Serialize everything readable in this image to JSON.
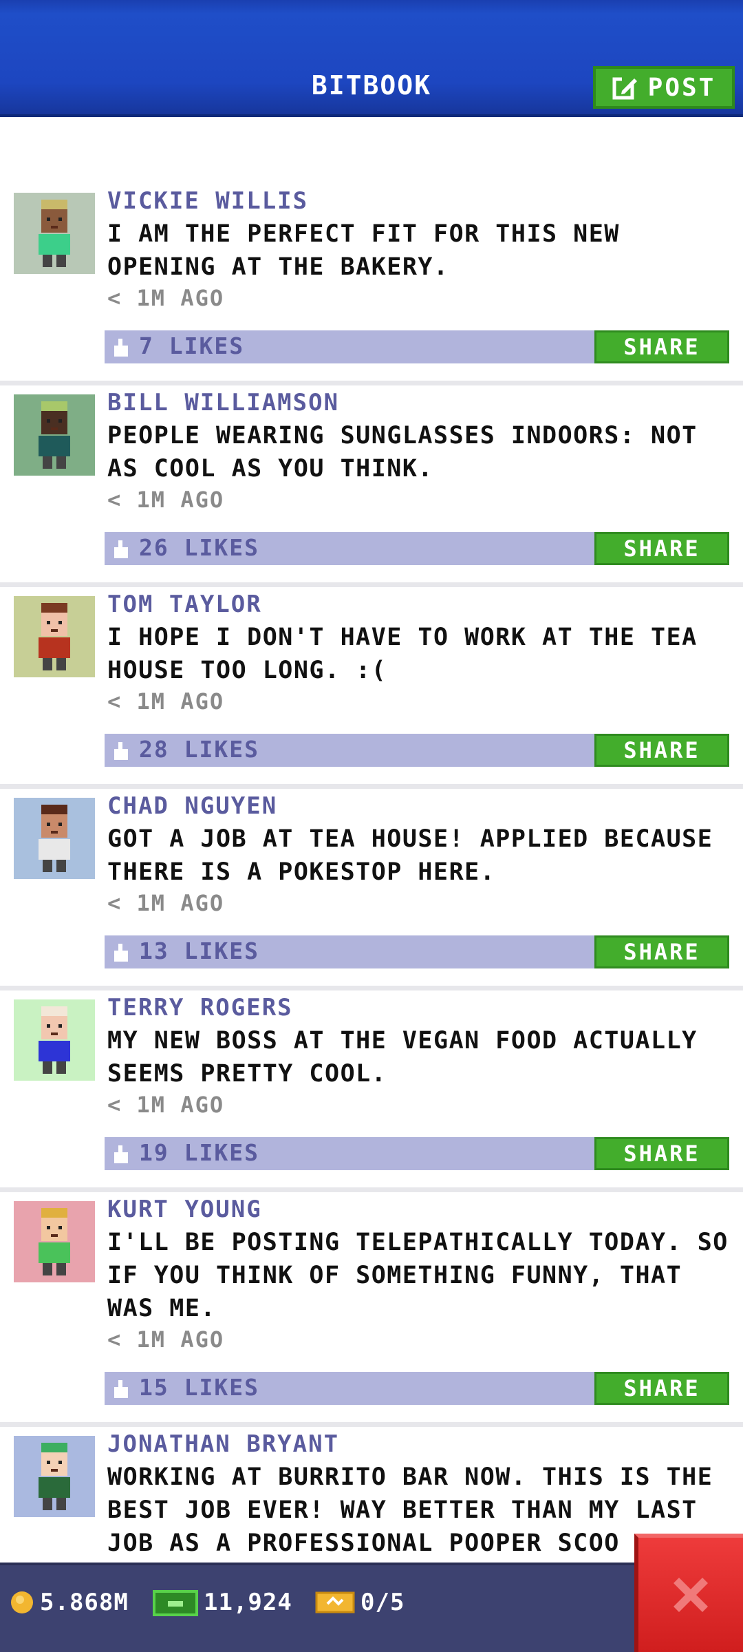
{
  "header": {
    "title": "BITBOOK",
    "post_label": "POST"
  },
  "posts": [
    {
      "name": "VICKIE WILLIS",
      "text": "I AM THE PERFECT FIT FOR THIS NEW OPENING AT THE BAKERY.",
      "time": "< 1M AGO",
      "likes": "7 LIKES",
      "share": "SHARE",
      "avatar_bg": "#b8c8b6",
      "skin": "#8a5a3c",
      "hair": "#c9b96a",
      "shirt": "#3ccf8a"
    },
    {
      "name": "BILL WILLIAMSON",
      "text": "PEOPLE WEARING SUNGLASSES INDOORS: NOT AS COOL AS YOU THINK.",
      "time": "< 1M AGO",
      "likes": "26 LIKES",
      "share": "SHARE",
      "avatar_bg": "#7fae86",
      "skin": "#4a2f22",
      "hair": "#a8c86a",
      "shirt": "#1f5a5a"
    },
    {
      "name": "TOM TAYLOR",
      "text": "I HOPE I DON'T HAVE TO WORK AT THE TEA HOUSE TOO LONG. :(",
      "time": "< 1M AGO",
      "likes": "28 LIKES",
      "share": "SHARE",
      "avatar_bg": "#c7cf96",
      "skin": "#f0c0a8",
      "hair": "#7a3a22",
      "shirt": "#b7331f"
    },
    {
      "name": "CHAD NGUYEN",
      "text": "GOT A JOB AT TEA HOUSE! APPLIED BECAUSE THERE IS A POKESTOP HERE.",
      "time": "< 1M AGO",
      "likes": "13 LIKES",
      "share": "SHARE",
      "avatar_bg": "#a9c0de",
      "skin": "#c98a6a",
      "hair": "#5a2a1a",
      "shirt": "#e8e8e8"
    },
    {
      "name": "TERRY ROGERS",
      "text": "MY NEW BOSS AT THE VEGAN FOOD ACTUALLY SEEMS PRETTY COOL.",
      "time": "< 1M AGO",
      "likes": "19 LIKES",
      "share": "SHARE",
      "avatar_bg": "#c9f2c2",
      "skin": "#f2c7b0",
      "hair": "#f3e7d8",
      "shirt": "#2d34d6"
    },
    {
      "name": "KURT YOUNG",
      "text": "I'LL BE POSTING TELEPATHICALLY TODAY. SO IF YOU THINK OF SOMETHING FUNNY, THAT WAS ME.",
      "time": "< 1M AGO",
      "likes": "15 LIKES",
      "share": "SHARE",
      "avatar_bg": "#e8a3ad",
      "skin": "#f2c7a0",
      "hair": "#e0b040",
      "shirt": "#4ac25a"
    },
    {
      "name": "JONATHAN BRYANT",
      "text": "WORKING AT BURRITO BAR NOW. THIS IS THE BEST JOB EVER! WAY BETTER THAN MY LAST JOB AS A PROFESSIONAL POOPER SCOO",
      "avatar_bg": "#aab9e0",
      "skin": "#f4d1b6",
      "hair": "#3cae60",
      "shirt": "#2a6a3a"
    }
  ],
  "footer": {
    "coins": "5.868M",
    "cash": "11,924",
    "tickets": "0/5"
  },
  "colors": {
    "header_blue": "#1d46c0",
    "share_green": "#43ad2c",
    "likes_bar": "#b1b4dc",
    "name_purple": "#5a5b9e",
    "close_red": "#d01e1e"
  }
}
